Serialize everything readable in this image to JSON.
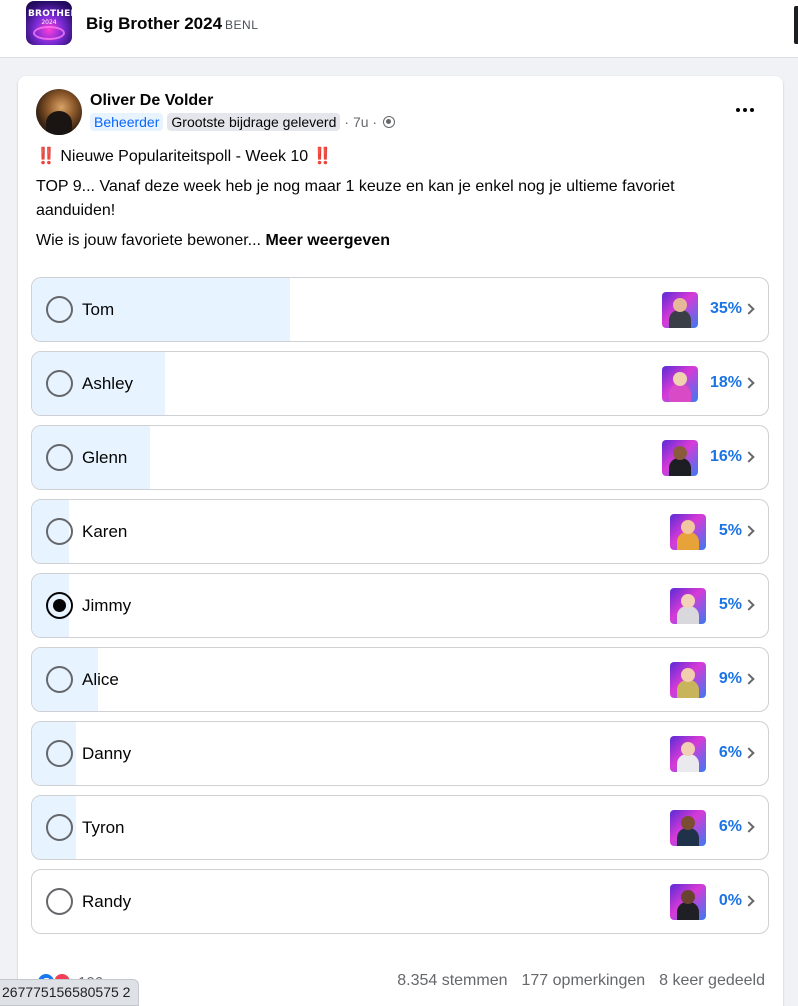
{
  "group": {
    "title": "Big Brother 2024",
    "tag": "BENL",
    "thumb_text": "BROTHER",
    "thumb_year": "2024"
  },
  "post": {
    "author": "Oliver De Volder",
    "badge_admin": "Beheerder",
    "badge_contributor": "Grootste bijdrage geleverd",
    "time": "· 7u ·",
    "title_marks": "‼️",
    "title": "Nieuwe Populariteitspoll - Week 10",
    "body": "TOP 9... Vanaf deze week heb je nog maar 1 keuze en kan je enkel nog je ultieme favoriet aanduiden!",
    "question": "Wie is  jouw favoriete bewoner...",
    "see_more": "Meer weergeven"
  },
  "poll": {
    "options": [
      {
        "name": "Tom",
        "percent": 35,
        "label": "35%",
        "selected": false,
        "fill": 0.35
      },
      {
        "name": "Ashley",
        "percent": 18,
        "label": "18%",
        "selected": false,
        "fill": 0.18
      },
      {
        "name": "Glenn",
        "percent": 16,
        "label": "16%",
        "selected": false,
        "fill": 0.16
      },
      {
        "name": "Karen",
        "percent": 5,
        "label": "5%",
        "selected": false,
        "fill": 0.05
      },
      {
        "name": "Jimmy",
        "percent": 5,
        "label": "5%",
        "selected": true,
        "fill": 0.05
      },
      {
        "name": "Alice",
        "percent": 9,
        "label": "9%",
        "selected": false,
        "fill": 0.09
      },
      {
        "name": "Danny",
        "percent": 6,
        "label": "6%",
        "selected": false,
        "fill": 0.06
      },
      {
        "name": "Tyron",
        "percent": 6,
        "label": "6%",
        "selected": false,
        "fill": 0.06
      },
      {
        "name": "Randy",
        "percent": 0,
        "label": "0%",
        "selected": false,
        "fill": 0.0
      }
    ]
  },
  "footer": {
    "reaction_count": "106",
    "votes": "8.354 stemmen",
    "comments": "177 opmerkingen",
    "shares": "8 keer gedeeld"
  },
  "status_url": "267775156580575 2",
  "colors": {
    "accent": "#1b74e4",
    "fill": "#e7f3ff",
    "admin_badge_text": "#0866ff"
  }
}
